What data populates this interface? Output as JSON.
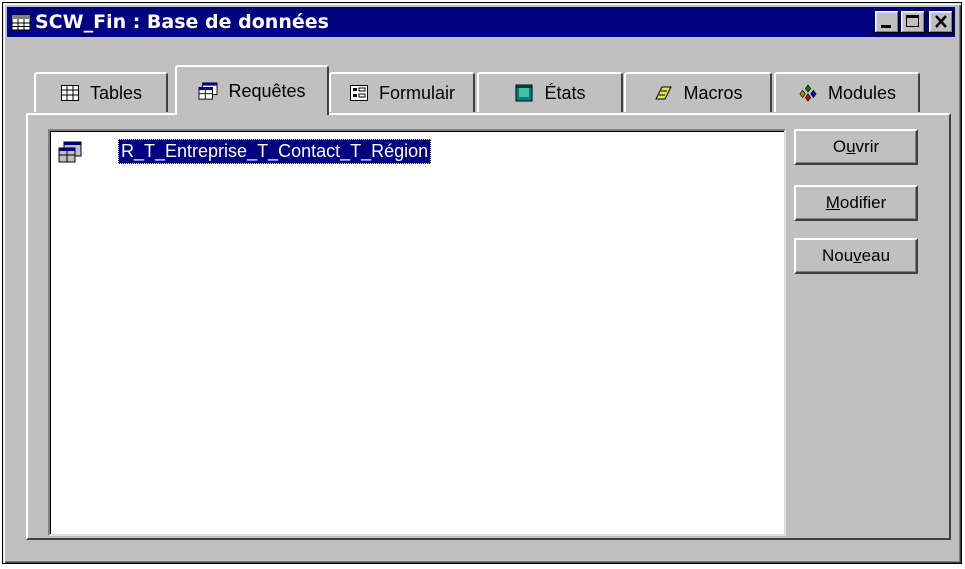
{
  "window": {
    "title": "SCW_Fin : Base de données",
    "title_bar_color": "#000080"
  },
  "tabs": [
    {
      "label": "Tables",
      "icon": "table-icon",
      "active": false
    },
    {
      "label": "Requêtes",
      "icon": "query-icon",
      "active": true
    },
    {
      "label": "Formulair",
      "icon": "form-icon",
      "active": false
    },
    {
      "label": "États",
      "icon": "report-icon",
      "active": false
    },
    {
      "label": "Macros",
      "icon": "macro-icon",
      "active": false
    },
    {
      "label": "Modules",
      "icon": "module-icon",
      "active": false
    }
  ],
  "list": {
    "items": [
      {
        "label": "R_T_Entreprise_T_Contact_T_Région",
        "selected": true,
        "icon": "query-icon"
      }
    ]
  },
  "buttons": {
    "open": {
      "before": "O",
      "mnemonic": "u",
      "after": "vrir"
    },
    "modify": {
      "before": "",
      "mnemonic": "M",
      "after": "odifier"
    },
    "new": {
      "before": "Nou",
      "mnemonic": "v",
      "after": "eau"
    }
  },
  "colors": {
    "face": "#c0c0c0",
    "selection": "#000080"
  }
}
